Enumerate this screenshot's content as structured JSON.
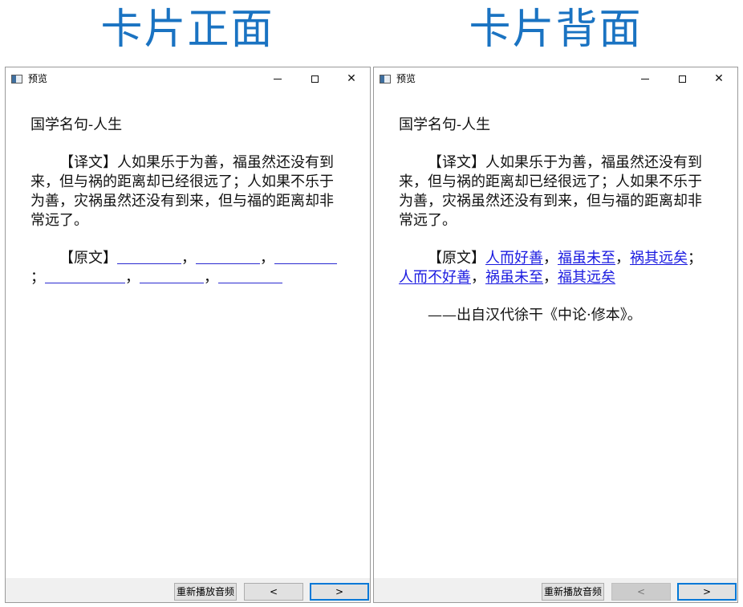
{
  "headings": {
    "front": "卡片正面",
    "back": "卡片背面"
  },
  "window": {
    "title": "预览",
    "minimize": "minimize-icon",
    "maximize": "maximize-icon",
    "close_glyph": "✕"
  },
  "card": {
    "title": "国学名句-人生",
    "translation": "【译文】人如果乐于为善，福虽然还没有到来，但与祸的距离却已经很远了；人如果不乐于为善，灾祸虽然还没有到来，但与福的距离却非常远了。",
    "original_label": "【原文】",
    "answers": [
      "人而好善",
      "福虽未至",
      "祸其远矣",
      "人而不好善",
      "祸虽未至",
      "福其远矣"
    ],
    "punct": {
      "comma": "，",
      "semicolon": "；"
    },
    "source": "——出自汉代徐干《中论·修本》。"
  },
  "buttons": {
    "replay": "重新播放音频",
    "prev": "<",
    "next": ">"
  },
  "colors": {
    "heading": "#1a73c2",
    "answer_link": "#1a1ae0",
    "focus": "#0078d7"
  }
}
